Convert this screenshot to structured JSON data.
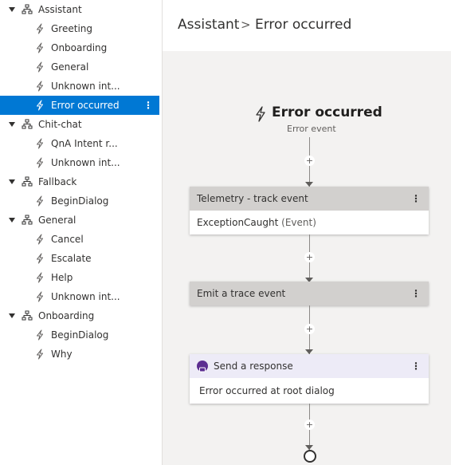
{
  "sidebar": {
    "rows": [
      {
        "kind": "dialog",
        "label": "Assistant"
      },
      {
        "kind": "trigger",
        "label": "Greeting"
      },
      {
        "kind": "trigger",
        "label": "Onboarding"
      },
      {
        "kind": "trigger",
        "label": "General"
      },
      {
        "kind": "trigger",
        "label": "Unknown int..."
      },
      {
        "kind": "trigger",
        "label": "Error occurred",
        "selected": true
      },
      {
        "kind": "dialog",
        "label": "Chit-chat"
      },
      {
        "kind": "trigger",
        "label": "QnA Intent r..."
      },
      {
        "kind": "trigger",
        "label": "Unknown int..."
      },
      {
        "kind": "dialog",
        "label": "Fallback"
      },
      {
        "kind": "trigger",
        "label": "BeginDialog"
      },
      {
        "kind": "dialog",
        "label": "General"
      },
      {
        "kind": "trigger",
        "label": "Cancel"
      },
      {
        "kind": "trigger",
        "label": "Escalate"
      },
      {
        "kind": "trigger",
        "label": "Help"
      },
      {
        "kind": "trigger",
        "label": "Unknown int..."
      },
      {
        "kind": "dialog",
        "label": "Onboarding"
      },
      {
        "kind": "trigger",
        "label": "BeginDialog"
      },
      {
        "kind": "trigger",
        "label": "Why"
      }
    ],
    "kebab_glyph": "⋮"
  },
  "breadcrumb": {
    "root": "Assistant",
    "separator": ">",
    "current": "Error occurred"
  },
  "trigger": {
    "title": "Error occurred",
    "subtitle": "Error event"
  },
  "actions": [
    {
      "title": "Telemetry - track event",
      "body": "ExceptionCaught",
      "body_suffix": "(Event)"
    },
    {
      "title": "Emit a trace event"
    },
    {
      "title": "Send a response",
      "body": "Error occurred at root dialog"
    }
  ],
  "add_glyph": "+",
  "menu_glyph": "⋮",
  "colors": {
    "selected": "#0078d4",
    "message_icon": "#5c2e91"
  }
}
